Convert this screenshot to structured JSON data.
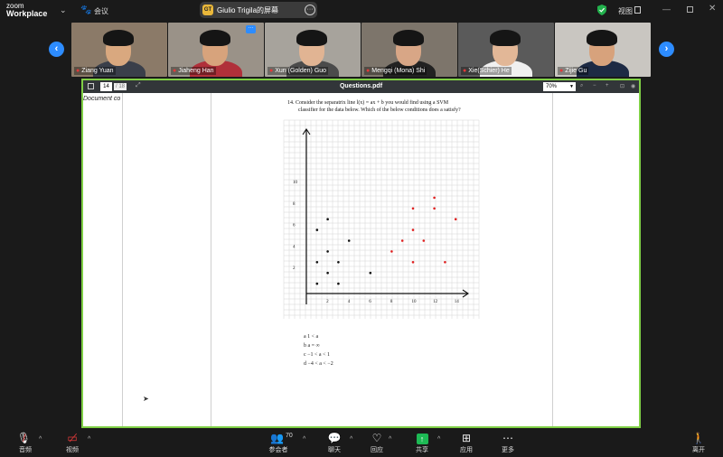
{
  "topbar": {
    "brand_line1": "zoom",
    "brand_line2": "Workplace",
    "meeting_label": "会议",
    "share_initials": "GT",
    "share_label": "Giulio Trigila的屏幕",
    "view_label": "视图"
  },
  "participants": [
    {
      "name": "Ziang Yuan",
      "bg": "#8b7a68",
      "skin": "#d9a87f",
      "shirt": "#3a3f4a"
    },
    {
      "name": "Jiaheng Han",
      "bg": "#9a9288",
      "skin": "#d7a37c",
      "shirt": "#b0303a"
    },
    {
      "name": "Xun (Golden) Guo",
      "bg": "#a7a39c",
      "skin": "#e1b493",
      "shirt": "#4b4b4b"
    },
    {
      "name": "Mengqi (Mona) Shi",
      "bg": "#7d756b",
      "skin": "#d8a686",
      "shirt": "#222222"
    },
    {
      "name": "Xie(Schier) He",
      "bg": "#5a5a5a",
      "skin": "#e2b797",
      "shirt": "#f0f0f0"
    },
    {
      "name": "Zijie Gu",
      "bg": "#c9c6c1",
      "skin": "#d7a27c",
      "shirt": "#1d2a44"
    }
  ],
  "pdf": {
    "page_number": "14",
    "page_count": "/ 18",
    "title": "Questions.pdf",
    "zoom": "70%",
    "sidebar_text": "Document co"
  },
  "question": {
    "line1": "14.  Consider the separatrix line l(x) = ax + b you would find using a SVM",
    "line2": "classifier for the data below. Which of the below conditions does a satisfy?",
    "options": [
      "a  1 < a",
      "b  a = ∞",
      "c  −1 < a < 1",
      "d  −4 < a < −2"
    ]
  },
  "graph": {
    "x_ticks": [
      "2",
      "4",
      "6",
      "8",
      "10",
      "12",
      "14"
    ],
    "y_ticks": [
      "2",
      "4",
      "6",
      "8",
      "10"
    ],
    "black_points": [
      [
        1,
        1
      ],
      [
        1,
        3
      ],
      [
        1,
        6
      ],
      [
        2,
        2
      ],
      [
        2,
        4
      ],
      [
        2,
        7
      ],
      [
        3,
        1
      ],
      [
        3,
        3
      ],
      [
        4,
        5
      ],
      [
        6,
        2
      ]
    ],
    "red_points": [
      [
        8,
        4
      ],
      [
        9,
        5
      ],
      [
        10,
        3
      ],
      [
        10,
        6
      ],
      [
        10,
        8
      ],
      [
        11,
        5
      ],
      [
        12,
        8
      ],
      [
        12,
        9
      ],
      [
        13,
        3
      ],
      [
        14,
        7
      ]
    ],
    "axis_color": "#111111",
    "red_color": "#e02020"
  },
  "bottombar": {
    "audio": "音频",
    "video": "视频",
    "participants": "参会者",
    "participant_count": "70",
    "chat": "聊天",
    "reactions": "回应",
    "share": "共享",
    "apps": "应用",
    "more": "更多",
    "leave": "离开"
  }
}
